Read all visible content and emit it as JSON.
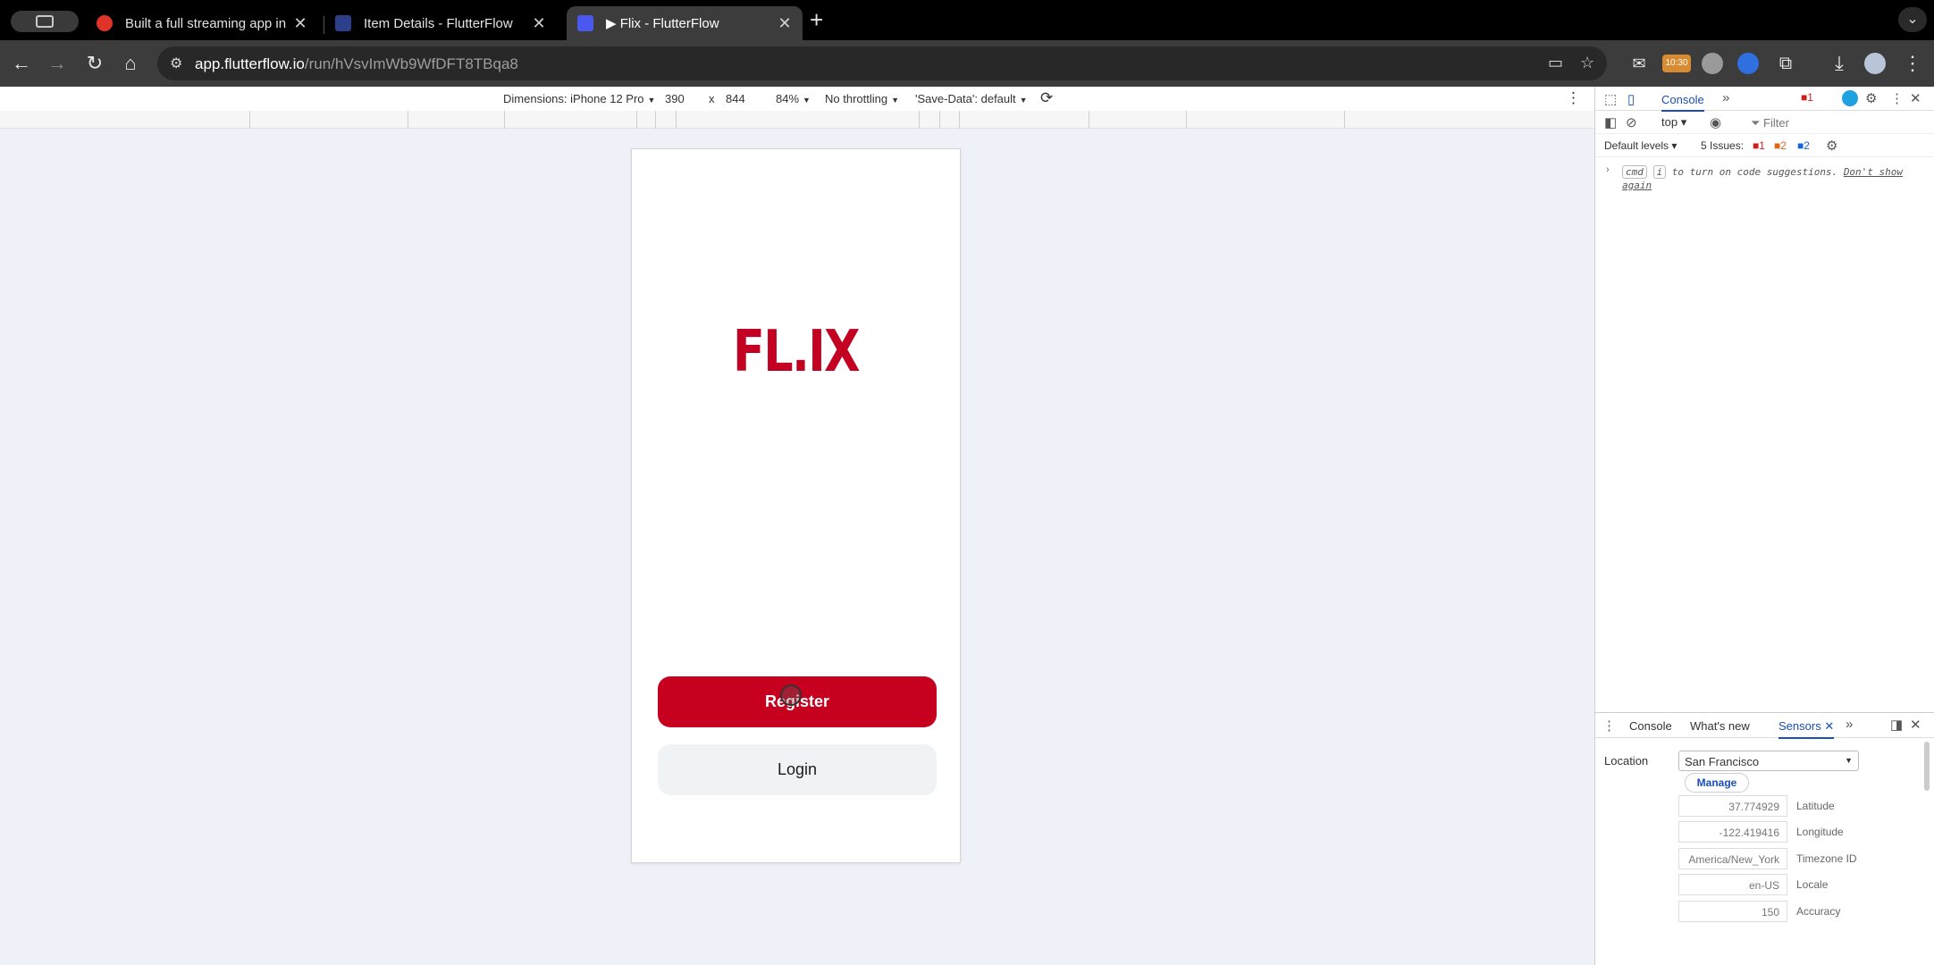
{
  "browser": {
    "tabs": [
      {
        "title": "Built a full streaming app in Fl",
        "favicon_color": "#e0342b",
        "active": false
      },
      {
        "title": "Item Details - FlutterFlow",
        "favicon_color": "#2b3f8a",
        "active": false
      },
      {
        "title": "▶ Flix - FlutterFlow",
        "favicon_color": "#4b58f0",
        "active": true
      }
    ],
    "url_host": "app.flutterflow.io",
    "url_path": "/run/hVsvImWb9WfDFT8TBqa8",
    "extension_badge": "10:30"
  },
  "device_toolbar": {
    "dimensions_label": "Dimensions: iPhone 12 Pro",
    "width": "390",
    "times": "x",
    "height": "844",
    "zoom": "84%",
    "throttling": "No throttling",
    "save_data": "'Save-Data': default"
  },
  "app": {
    "logo_text": "FL.IX",
    "register_label": "Register",
    "login_label": "Login",
    "brand_color": "#c8001f"
  },
  "devtools": {
    "main_tab": "Console",
    "issues_badge": "1",
    "context": "top",
    "filter_placeholder": "Filter",
    "levels": "Default levels",
    "issues_label": "5 Issues:",
    "issue_errors": "1",
    "issue_warnings": "2",
    "issue_info": "2",
    "hint_kbd1": "cmd",
    "hint_kbd2": "i",
    "hint_text": "to turn on code suggestions.",
    "hint_link": "Don't show again",
    "drawer_tabs": [
      "Console",
      "What's new",
      "Sensors"
    ],
    "sensors": {
      "location_label": "Location",
      "location_value": "San Francisco",
      "manage_label": "Manage",
      "fields": [
        {
          "value": "37.774929",
          "label": "Latitude"
        },
        {
          "value": "-122.419416",
          "label": "Longitude"
        },
        {
          "value": "America/New_York",
          "label": "Timezone ID"
        },
        {
          "value": "en-US",
          "label": "Locale"
        },
        {
          "value": "150",
          "label": "Accuracy"
        }
      ]
    }
  }
}
